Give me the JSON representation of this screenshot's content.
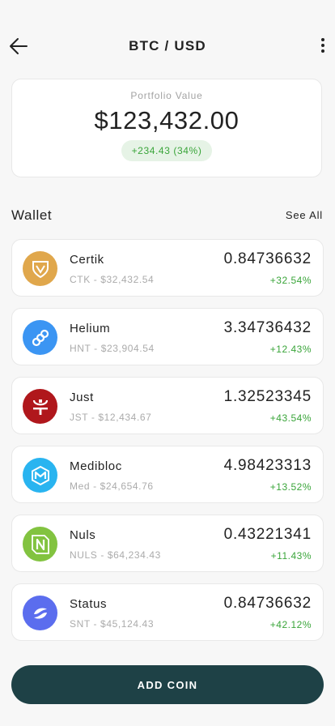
{
  "header": {
    "title": "BTC / USD"
  },
  "portfolio": {
    "label": "Portfolio Value",
    "value": "$123,432.00",
    "change": "+234.43 (34%)"
  },
  "wallet": {
    "title": "Wallet",
    "see_all": "See All",
    "coins": [
      {
        "name": "Certik",
        "sub": "CTK - $32,432.54",
        "amount": "0.84736632",
        "change": "+32.54%",
        "color": "#e0a74c",
        "icon": "certik-icon"
      },
      {
        "name": "Helium",
        "sub": "HNT - $23,904.54",
        "amount": "3.34736432",
        "change": "+12.43%",
        "color": "#3b95f3",
        "icon": "helium-icon"
      },
      {
        "name": "Just",
        "sub": "JST - $12,434.67",
        "amount": "1.32523345",
        "change": "+43.54%",
        "color": "#b0171c",
        "icon": "just-icon"
      },
      {
        "name": "Medibloc",
        "sub": "Med - $24,654.76",
        "amount": "4.98423313",
        "change": "+13.52%",
        "color": "#29b4f0",
        "icon": "medibloc-icon"
      },
      {
        "name": "Nuls",
        "sub": "NULS - $64,234.43",
        "amount": "0.43221341",
        "change": "+11.43%",
        "color": "#82c340",
        "icon": "nuls-icon"
      },
      {
        "name": "Status",
        "sub": "SNT - $45,124.43",
        "amount": "0.84736632",
        "change": "+42.12%",
        "color": "#5b6dee",
        "icon": "status-icon"
      }
    ]
  },
  "actions": {
    "add_coin": "ADD COIN"
  },
  "colors": {
    "accent": "#1e4146",
    "positive": "#3aa53a",
    "positive_bg": "#e6f3e6"
  }
}
